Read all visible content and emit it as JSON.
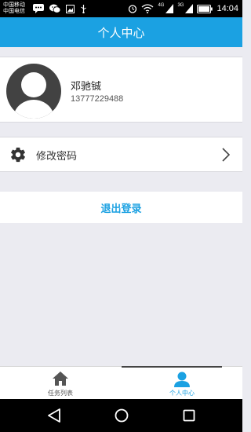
{
  "status_bar": {
    "carrier_line1": "中国移动",
    "carrier_line2": "中国电信",
    "network_4g": "4G",
    "network_3g": "3G",
    "time": "14:04"
  },
  "header": {
    "title": "个人中心"
  },
  "profile": {
    "name": "邓驰铖",
    "phone": "13777229488"
  },
  "settings": {
    "change_password_label": "修改密码"
  },
  "logout": {
    "label": "退出登录"
  },
  "tab_bar": {
    "tabs": [
      {
        "label": "任务列表"
      },
      {
        "label": "个人中心"
      }
    ],
    "active_index": 1
  },
  "colors": {
    "accent": "#1ba1e2",
    "background": "#ebebf1"
  },
  "icons": {
    "status": [
      "message-icon",
      "wechat-icon",
      "image-icon",
      "usb-icon",
      "alarm-icon",
      "wifi-icon",
      "signal-icon",
      "battery-icon"
    ],
    "row": [
      "gear-icon",
      "chevron-right-icon"
    ],
    "tabs": [
      "home-icon",
      "person-icon"
    ],
    "nav": [
      "back-icon",
      "home-circle-icon",
      "recent-apps-icon"
    ]
  }
}
